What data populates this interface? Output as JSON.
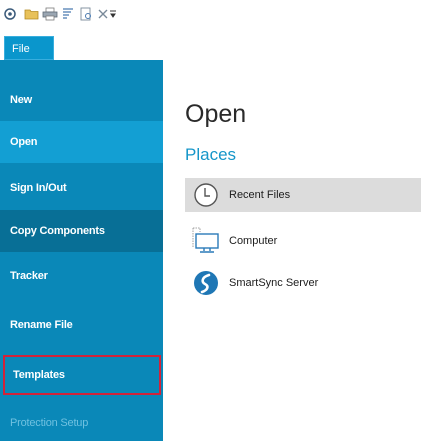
{
  "toolbar": {
    "icons": [
      "settings-icon",
      "open-folder-icon",
      "print-icon",
      "sort-icon",
      "preview-icon",
      "close-icon",
      "customize-dropdown-icon"
    ]
  },
  "file_tab": {
    "label": "File"
  },
  "sidebar": {
    "items": [
      {
        "label": "New",
        "state": "normal"
      },
      {
        "label": "Open",
        "state": "active"
      },
      {
        "label": "Sign In/Out",
        "state": "normal"
      },
      {
        "label": "Copy Components",
        "state": "dark"
      },
      {
        "label": "Tracker",
        "state": "normal"
      },
      {
        "label": "Rename File",
        "state": "normal"
      },
      {
        "label": "Templates",
        "state": "highlighted"
      },
      {
        "label": "Protection Setup",
        "state": "disabled"
      }
    ]
  },
  "main": {
    "title": "Open",
    "places_heading": "Places",
    "places": [
      {
        "label": "Recent Files",
        "icon": "clock-icon",
        "selected": true
      },
      {
        "label": "Computer",
        "icon": "computer-icon",
        "selected": false
      },
      {
        "label": "SmartSync Server",
        "icon": "smartsync-icon",
        "selected": false
      }
    ]
  },
  "colors": {
    "sidebar": "#0a88b8",
    "sidebar_active": "#139fd3",
    "sidebar_dark": "#086f96",
    "accent": "#1596c9",
    "highlight_border": "#d2233a",
    "selected_row": "#dcdcdc"
  }
}
